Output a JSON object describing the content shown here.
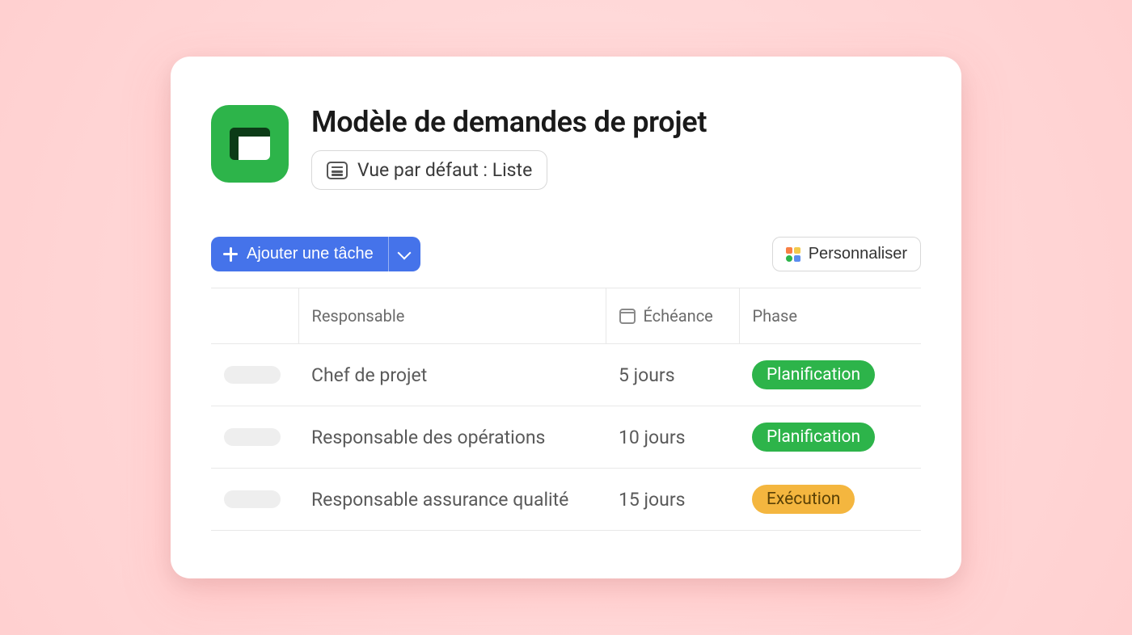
{
  "header": {
    "title": "Modèle de demandes de projet",
    "view_label": "Vue par défaut : Liste"
  },
  "toolbar": {
    "add_task_label": "Ajouter une tâche",
    "customize_label": "Personnaliser"
  },
  "table": {
    "columns": {
      "responsible": "Responsable",
      "due": "Échéance",
      "phase": "Phase"
    },
    "rows": [
      {
        "responsible": "Chef de projet",
        "due": "5 jours",
        "phase": "Planification",
        "phase_color": "green"
      },
      {
        "responsible": "Responsable des opérations",
        "due": "10 jours",
        "phase": "Planification",
        "phase_color": "green"
      },
      {
        "responsible": "Responsable assurance qualité",
        "due": "15 jours",
        "phase": "Exécution",
        "phase_color": "yellow"
      }
    ]
  },
  "colors": {
    "accent_blue": "#4573ea",
    "accent_green": "#2db44a",
    "accent_yellow": "#f4b63f"
  }
}
